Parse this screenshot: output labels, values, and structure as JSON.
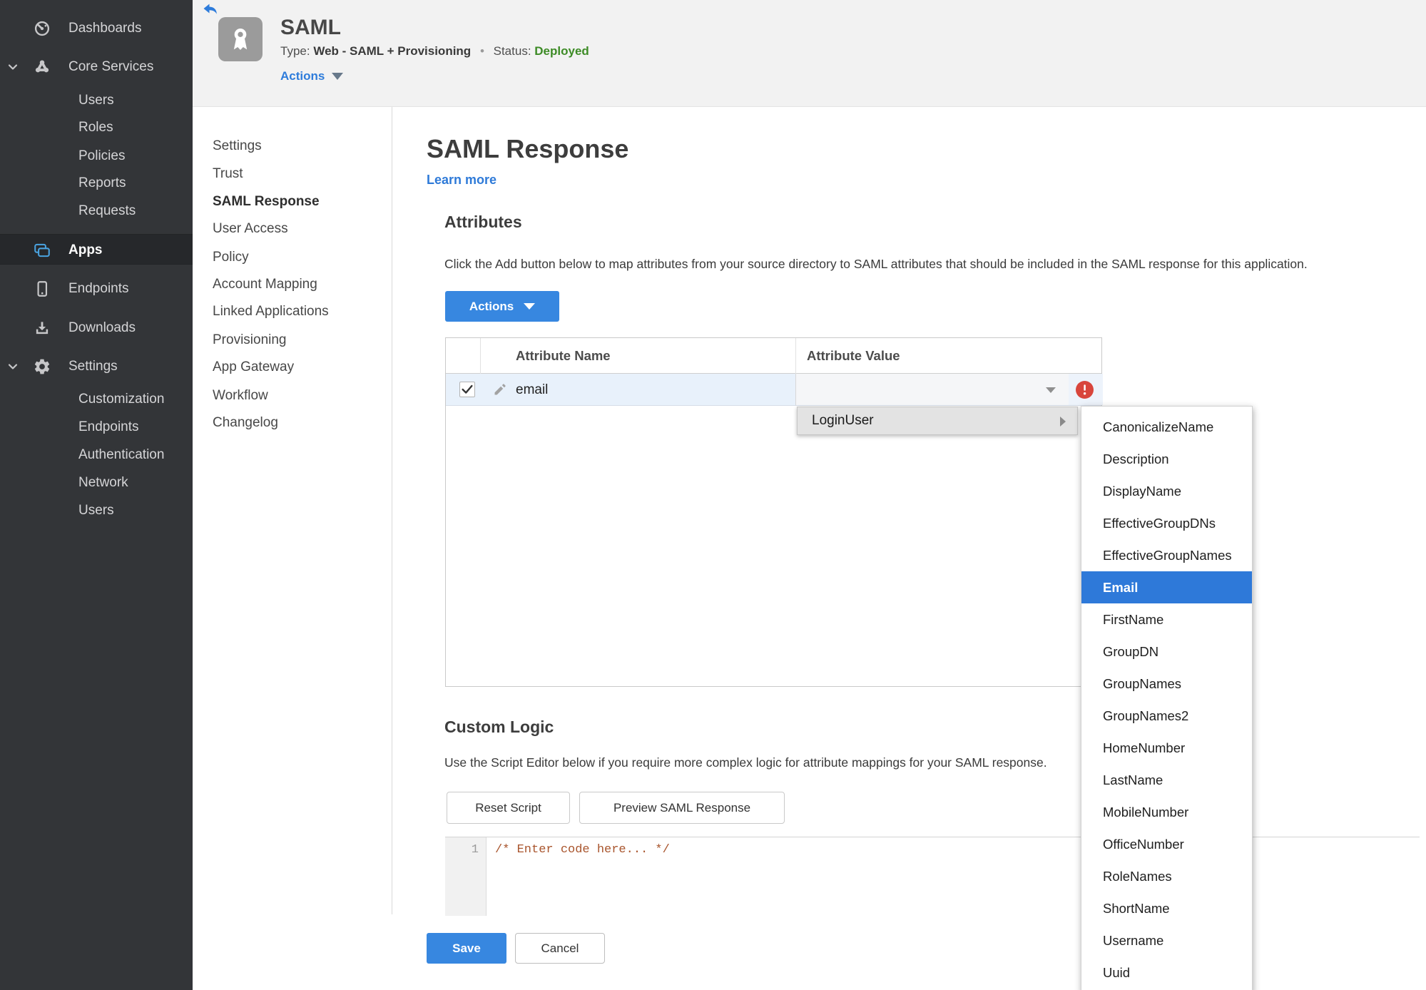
{
  "colors": {
    "accent_blue": "#3787e0",
    "link_blue": "#2e7ad8",
    "selection_blue": "#2e79d9",
    "status_green": "#3d8b26",
    "error_red": "#d8453c",
    "sidebar_bg": "#333538"
  },
  "icons": {
    "back": "back-arrow",
    "app_badge": "award-ribbon",
    "dashboards": "gauge",
    "core_services": "node-cluster",
    "apps": "stacked-windows",
    "endpoints": "smartphone",
    "downloads": "download-tray",
    "settings": "gear",
    "expand": "chevron-down",
    "row_edit": "pencil",
    "row_checked": "checkmark",
    "value_open": "caret-down",
    "submenu": "caret-right",
    "error": "exclamation-circle"
  },
  "sidebar": {
    "dashboards": "Dashboards",
    "core_services": "Core Services",
    "core_sub": [
      "Users",
      "Roles",
      "Policies",
      "Reports",
      "Requests"
    ],
    "apps": "Apps",
    "endpoints": "Endpoints",
    "downloads": "Downloads",
    "settings": "Settings",
    "settings_sub": [
      "Customization",
      "Endpoints",
      "Authentication",
      "Network",
      "Users"
    ]
  },
  "app_header": {
    "title": "SAML",
    "type_label": "Type:",
    "type_value": "Web - SAML + Provisioning",
    "dot": "•",
    "status_label": "Status:",
    "status_value": "Deployed",
    "actions_label": "Actions"
  },
  "subnav": {
    "items": [
      "Settings",
      "Trust",
      "SAML Response",
      "User Access",
      "Policy",
      "Account Mapping",
      "Linked Applications",
      "Provisioning",
      "App Gateway",
      "Workflow",
      "Changelog"
    ],
    "active": "SAML Response"
  },
  "main": {
    "title": "SAML Response",
    "learn_more": "Learn more",
    "attributes": {
      "heading": "Attributes",
      "description": "Click the Add button below to map attributes from your source directory to SAML attributes that should be included in the SAML response for this application.",
      "actions_button": "Actions"
    },
    "table": {
      "col_name": "Attribute Name",
      "col_value": "Attribute Value",
      "rows": [
        {
          "name": "email",
          "value": "",
          "checked": true,
          "error": true
        }
      ]
    },
    "value_menu": {
      "parent": "LoginUser",
      "selected": "Email",
      "items": [
        "CanonicalizeName",
        "Description",
        "DisplayName",
        "EffectiveGroupDNs",
        "EffectiveGroupNames",
        "Email",
        "FirstName",
        "GroupDN",
        "GroupNames",
        "GroupNames2",
        "HomeNumber",
        "LastName",
        "MobileNumber",
        "OfficeNumber",
        "RoleNames",
        "ShortName",
        "Username",
        "Uuid"
      ]
    },
    "custom_logic": {
      "heading": "Custom Logic",
      "description": "Use the Script Editor below if you require more complex logic for attribute mappings for your SAML response.",
      "reset_button": "Reset Script",
      "preview_button": "Preview SAML Response"
    },
    "editor": {
      "line_number": "1",
      "code": "/* Enter code here... */"
    },
    "footer": {
      "save": "Save",
      "cancel": "Cancel"
    }
  }
}
